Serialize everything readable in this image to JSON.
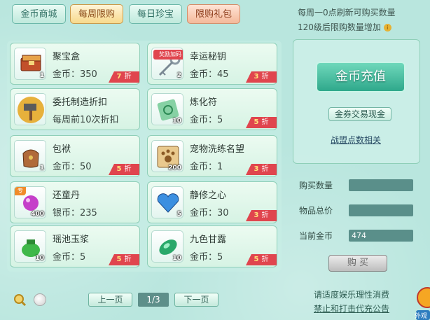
{
  "tabs": [
    {
      "label": "金币商城"
    },
    {
      "label": "每周限购"
    },
    {
      "label": "每日珍宝"
    },
    {
      "label": "限购礼包"
    }
  ],
  "notes": {
    "line1": "每周一0点刷新可购买数量",
    "line2": "120级后限购数量增加",
    "info_icon": "i"
  },
  "items": [
    {
      "name": "聚宝盒",
      "price": "金币：350",
      "qty": "1",
      "discount_num": "7",
      "discount_unit": "折"
    },
    {
      "name": "幸运秘钥",
      "price": "金币：45",
      "qty": "2",
      "discount_num": "3",
      "discount_unit": "折",
      "tag": "奖励加码"
    },
    {
      "name": "委托制造折扣",
      "price": "每周前10次折扣",
      "qty": "",
      "discount_num": "",
      "discount_unit": ""
    },
    {
      "name": "炼化符",
      "price": "金币：5",
      "qty": "10",
      "discount_num": "5",
      "discount_unit": "折"
    },
    {
      "name": "包袱",
      "price": "金币：50",
      "qty": "1",
      "discount_num": "5",
      "discount_unit": "折"
    },
    {
      "name": "宠物洗练名望",
      "price": "金币：1",
      "qty": "200",
      "discount_num": "3",
      "discount_unit": "折"
    },
    {
      "name": "还童丹",
      "price": "银币：235",
      "qty": "400",
      "discount_num": "",
      "discount_unit": "",
      "flag": "专"
    },
    {
      "name": "静修之心",
      "price": "金币：30",
      "qty": "5",
      "discount_num": "3",
      "discount_unit": "折"
    },
    {
      "name": "瑶池玉浆",
      "price": "金币：5",
      "qty": "10",
      "discount_num": "5",
      "discount_unit": "折"
    },
    {
      "name": "九色甘露",
      "price": "金币：5",
      "qty": "10",
      "discount_num": "5",
      "discount_unit": "折"
    }
  ],
  "right": {
    "recharge": "金币充值",
    "exchange": "金券交易现金",
    "link": "战盟点数相关",
    "buy_qty_label": "购买数量",
    "total_label": "物品总价",
    "current_label": "当前金币",
    "current_value": "474",
    "buy_label": "购 买"
  },
  "pager": {
    "prev": "上一页",
    "page": "1/3",
    "next": "下一页"
  },
  "footer": {
    "line1": "请适度娱乐理性消费",
    "line2": "禁止和打击代充公告",
    "corner": "外观"
  },
  "colors": {
    "accent": "#2fa88b",
    "discount": "#e0454e",
    "background": "#b9e6de"
  }
}
